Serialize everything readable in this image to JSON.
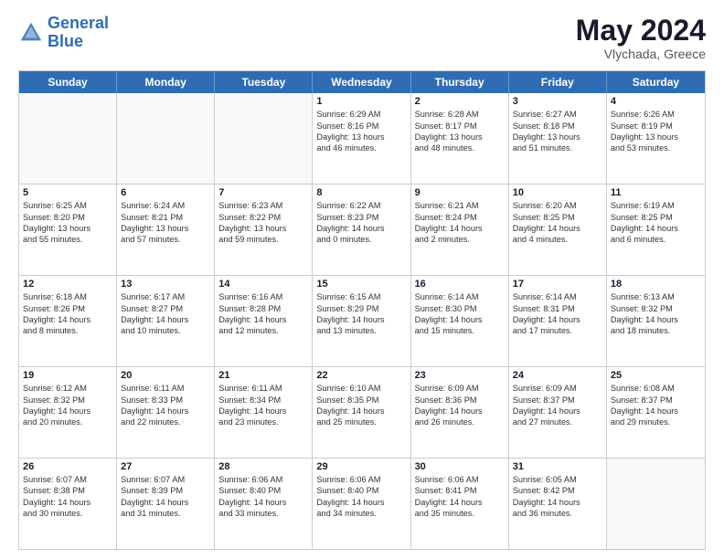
{
  "header": {
    "logo_line1": "General",
    "logo_line2": "Blue",
    "month": "May 2024",
    "location": "Vlychada, Greece"
  },
  "weekdays": [
    "Sunday",
    "Monday",
    "Tuesday",
    "Wednesday",
    "Thursday",
    "Friday",
    "Saturday"
  ],
  "rows": [
    [
      {
        "day": "",
        "lines": []
      },
      {
        "day": "",
        "lines": []
      },
      {
        "day": "",
        "lines": []
      },
      {
        "day": "1",
        "lines": [
          "Sunrise: 6:29 AM",
          "Sunset: 8:16 PM",
          "Daylight: 13 hours",
          "and 46 minutes."
        ]
      },
      {
        "day": "2",
        "lines": [
          "Sunrise: 6:28 AM",
          "Sunset: 8:17 PM",
          "Daylight: 13 hours",
          "and 48 minutes."
        ]
      },
      {
        "day": "3",
        "lines": [
          "Sunrise: 6:27 AM",
          "Sunset: 8:18 PM",
          "Daylight: 13 hours",
          "and 51 minutes."
        ]
      },
      {
        "day": "4",
        "lines": [
          "Sunrise: 6:26 AM",
          "Sunset: 8:19 PM",
          "Daylight: 13 hours",
          "and 53 minutes."
        ]
      }
    ],
    [
      {
        "day": "5",
        "lines": [
          "Sunrise: 6:25 AM",
          "Sunset: 8:20 PM",
          "Daylight: 13 hours",
          "and 55 minutes."
        ]
      },
      {
        "day": "6",
        "lines": [
          "Sunrise: 6:24 AM",
          "Sunset: 8:21 PM",
          "Daylight: 13 hours",
          "and 57 minutes."
        ]
      },
      {
        "day": "7",
        "lines": [
          "Sunrise: 6:23 AM",
          "Sunset: 8:22 PM",
          "Daylight: 13 hours",
          "and 59 minutes."
        ]
      },
      {
        "day": "8",
        "lines": [
          "Sunrise: 6:22 AM",
          "Sunset: 8:23 PM",
          "Daylight: 14 hours",
          "and 0 minutes."
        ]
      },
      {
        "day": "9",
        "lines": [
          "Sunrise: 6:21 AM",
          "Sunset: 8:24 PM",
          "Daylight: 14 hours",
          "and 2 minutes."
        ]
      },
      {
        "day": "10",
        "lines": [
          "Sunrise: 6:20 AM",
          "Sunset: 8:25 PM",
          "Daylight: 14 hours",
          "and 4 minutes."
        ]
      },
      {
        "day": "11",
        "lines": [
          "Sunrise: 6:19 AM",
          "Sunset: 8:25 PM",
          "Daylight: 14 hours",
          "and 6 minutes."
        ]
      }
    ],
    [
      {
        "day": "12",
        "lines": [
          "Sunrise: 6:18 AM",
          "Sunset: 8:26 PM",
          "Daylight: 14 hours",
          "and 8 minutes."
        ]
      },
      {
        "day": "13",
        "lines": [
          "Sunrise: 6:17 AM",
          "Sunset: 8:27 PM",
          "Daylight: 14 hours",
          "and 10 minutes."
        ]
      },
      {
        "day": "14",
        "lines": [
          "Sunrise: 6:16 AM",
          "Sunset: 8:28 PM",
          "Daylight: 14 hours",
          "and 12 minutes."
        ]
      },
      {
        "day": "15",
        "lines": [
          "Sunrise: 6:15 AM",
          "Sunset: 8:29 PM",
          "Daylight: 14 hours",
          "and 13 minutes."
        ]
      },
      {
        "day": "16",
        "lines": [
          "Sunrise: 6:14 AM",
          "Sunset: 8:30 PM",
          "Daylight: 14 hours",
          "and 15 minutes."
        ]
      },
      {
        "day": "17",
        "lines": [
          "Sunrise: 6:14 AM",
          "Sunset: 8:31 PM",
          "Daylight: 14 hours",
          "and 17 minutes."
        ]
      },
      {
        "day": "18",
        "lines": [
          "Sunrise: 6:13 AM",
          "Sunset: 8:32 PM",
          "Daylight: 14 hours",
          "and 18 minutes."
        ]
      }
    ],
    [
      {
        "day": "19",
        "lines": [
          "Sunrise: 6:12 AM",
          "Sunset: 8:32 PM",
          "Daylight: 14 hours",
          "and 20 minutes."
        ]
      },
      {
        "day": "20",
        "lines": [
          "Sunrise: 6:11 AM",
          "Sunset: 8:33 PM",
          "Daylight: 14 hours",
          "and 22 minutes."
        ]
      },
      {
        "day": "21",
        "lines": [
          "Sunrise: 6:11 AM",
          "Sunset: 8:34 PM",
          "Daylight: 14 hours",
          "and 23 minutes."
        ]
      },
      {
        "day": "22",
        "lines": [
          "Sunrise: 6:10 AM",
          "Sunset: 8:35 PM",
          "Daylight: 14 hours",
          "and 25 minutes."
        ]
      },
      {
        "day": "23",
        "lines": [
          "Sunrise: 6:09 AM",
          "Sunset: 8:36 PM",
          "Daylight: 14 hours",
          "and 26 minutes."
        ]
      },
      {
        "day": "24",
        "lines": [
          "Sunrise: 6:09 AM",
          "Sunset: 8:37 PM",
          "Daylight: 14 hours",
          "and 27 minutes."
        ]
      },
      {
        "day": "25",
        "lines": [
          "Sunrise: 6:08 AM",
          "Sunset: 8:37 PM",
          "Daylight: 14 hours",
          "and 29 minutes."
        ]
      }
    ],
    [
      {
        "day": "26",
        "lines": [
          "Sunrise: 6:07 AM",
          "Sunset: 8:38 PM",
          "Daylight: 14 hours",
          "and 30 minutes."
        ]
      },
      {
        "day": "27",
        "lines": [
          "Sunrise: 6:07 AM",
          "Sunset: 8:39 PM",
          "Daylight: 14 hours",
          "and 31 minutes."
        ]
      },
      {
        "day": "28",
        "lines": [
          "Sunrise: 6:06 AM",
          "Sunset: 8:40 PM",
          "Daylight: 14 hours",
          "and 33 minutes."
        ]
      },
      {
        "day": "29",
        "lines": [
          "Sunrise: 6:06 AM",
          "Sunset: 8:40 PM",
          "Daylight: 14 hours",
          "and 34 minutes."
        ]
      },
      {
        "day": "30",
        "lines": [
          "Sunrise: 6:06 AM",
          "Sunset: 8:41 PM",
          "Daylight: 14 hours",
          "and 35 minutes."
        ]
      },
      {
        "day": "31",
        "lines": [
          "Sunrise: 6:05 AM",
          "Sunset: 8:42 PM",
          "Daylight: 14 hours",
          "and 36 minutes."
        ]
      },
      {
        "day": "",
        "lines": []
      }
    ]
  ]
}
